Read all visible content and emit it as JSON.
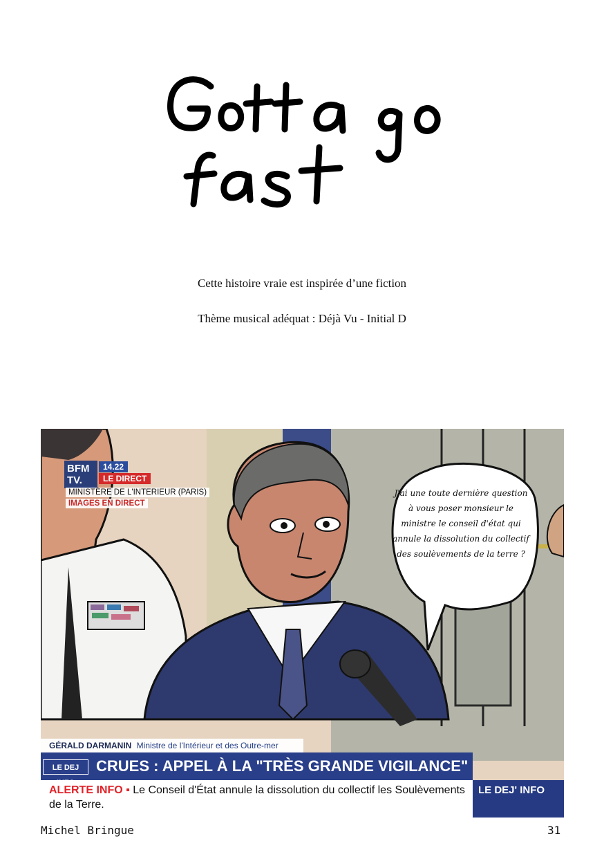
{
  "title": {
    "line1": "Gotta go",
    "line2": "fast"
  },
  "captions": {
    "line1": "Cette histoire vraie est inspirée d’une fiction",
    "line2": "Thème musical adéquat : Déjà Vu - Initial D"
  },
  "tv_overlay": {
    "channel": "BFM TV.",
    "time": "14.22",
    "direct": "LE DIRECT",
    "location": "MINISTÈRE DE L'INTERIEUR (PARIS)",
    "live": "IMAGES EN DIRECT"
  },
  "speech_bubble": "J'ai une toute dernière question à vous poser monsieur le ministre le conseil d'état qui annule la dissolution du collectif des soulèvements de la terre ?",
  "lower_third": {
    "name": "GÉRALD DARMANIN",
    "role": "Ministre de l'Intérieur et des Outre-mer",
    "show_logo": "LE DEJ INFO",
    "headline": "CRUES : APPEL À LA \"TRÈS GRANDE VIGILANCE\"",
    "alert_label": "ALERTE INFO ▪",
    "alert_text": "Le Conseil d'État annule la dissolution du collectif les Soulèvements de la Terre.",
    "side_label": "LE DEJ' INFO"
  },
  "footer": {
    "author": "Michel Bringue",
    "page_number": "31"
  },
  "colors": {
    "bfm_blue": "#2a3f8a",
    "alert_red": "#e0242a",
    "skin": "#c8866f",
    "suit": "#2e3a6e",
    "wall": "#b6b3a6"
  }
}
